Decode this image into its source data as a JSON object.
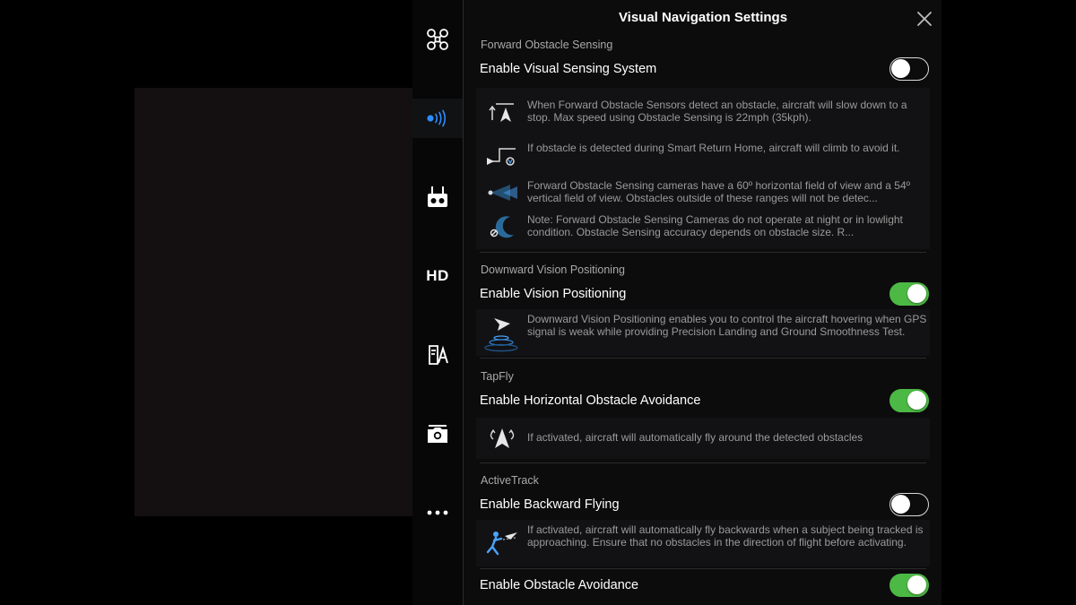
{
  "panel": {
    "title": "Visual Navigation Settings",
    "close_icon": "close-icon"
  },
  "rail": {
    "items": [
      {
        "icon": "aircraft-icon"
      },
      {
        "icon": "obstacle-sensing-icon",
        "active": true
      },
      {
        "icon": "remote-controller-icon"
      },
      {
        "icon": "hd-icon",
        "label": "HD"
      },
      {
        "icon": "battery-icon"
      },
      {
        "icon": "camera-icon"
      },
      {
        "icon": "more-icon"
      }
    ]
  },
  "sections": {
    "forward": {
      "header": "Forward Obstacle Sensing",
      "toggle_label": "Enable Visual Sensing System",
      "toggle_on": false,
      "items": [
        {
          "icon": "obstacle-slowdown-icon",
          "text": "When Forward Obstacle Sensors detect an obstacle, aircraft will slow down to a stop. Max speed using Obstacle Sensing is 22mph (35kph)."
        },
        {
          "icon": "return-home-climb-icon",
          "text": "If obstacle is detected during Smart Return Home, aircraft will climb to avoid it."
        },
        {
          "icon": "field-of-view-icon",
          "text": "Forward Obstacle Sensing cameras have a 60º horizontal field of view and a 54º vertical field of view. Obstacles outside of these ranges will not be detec..."
        },
        {
          "icon": "night-mode-icon",
          "text": "Note: Forward Obstacle Sensing Cameras do not operate at night or in lowlight condition. Obstacle Sensing accuracy depends on obstacle size. R..."
        }
      ]
    },
    "downward": {
      "header": "Downward Vision Positioning",
      "toggle_label": "Enable Vision Positioning",
      "toggle_on": true,
      "items": [
        {
          "icon": "vision-positioning-icon",
          "text": "Downward Vision Positioning enables you to control the aircraft hovering when GPS signal is weak while providing Precision Landing and Ground Smoothness Test."
        }
      ]
    },
    "tapfly": {
      "header": "TapFly",
      "toggle_label": "Enable Horizontal Obstacle Avoidance",
      "toggle_on": true,
      "items": [
        {
          "icon": "horizontal-avoidance-icon",
          "text": "If activated, aircraft will automatically fly around the detected obstacles"
        }
      ]
    },
    "activetrack": {
      "header": "ActiveTrack",
      "toggle_label": "Enable Backward Flying",
      "toggle_on": false,
      "items": [
        {
          "icon": "backward-flying-icon",
          "text": "If activated, aircraft will automatically fly backwards when a subject being tracked is approaching. Ensure that no obstacles in the direction of flight before activating."
        }
      ],
      "second_toggle_label": "Enable Obstacle Avoidance",
      "second_toggle_on": true
    }
  },
  "colors": {
    "toggle_on": "#4cb944",
    "active_accent": "#2f8cff",
    "panel_bg": "#0c0c0d"
  }
}
